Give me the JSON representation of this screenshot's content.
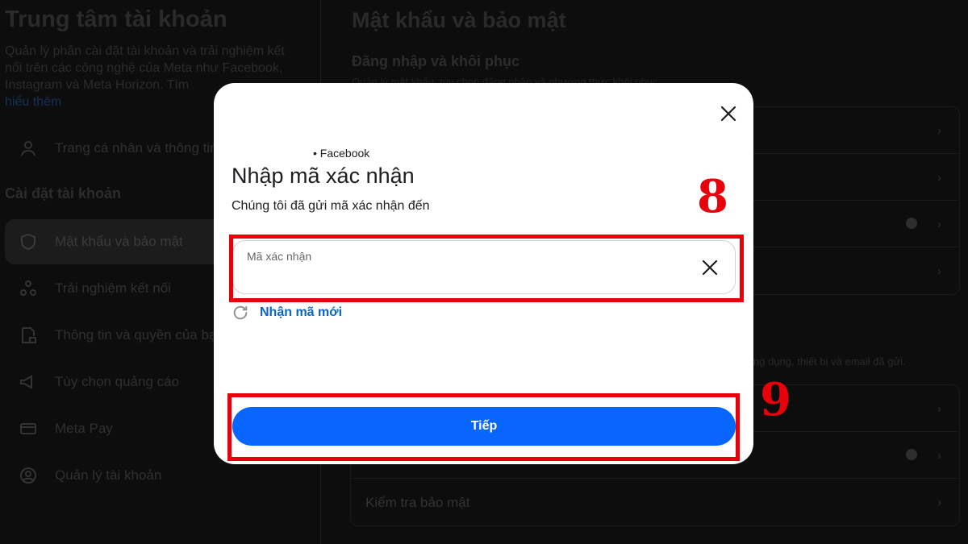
{
  "account_center": {
    "title": "Trung tâm tài khoản",
    "description": "Quản lý phần cài đặt tài khoản và trải nghiệm kết nối trên các công nghệ của Meta như Facebook, Instagram và Meta Horizon. Tìm",
    "learn_more": "hiểu thêm",
    "profile_item": "Trang cá nhân và thông tin",
    "settings_heading": "Cài đặt tài khoản",
    "nav": [
      {
        "label": "Mật khẩu và bảo mật",
        "icon": "shield-icon"
      },
      {
        "label": "Trải nghiệm kết nối",
        "icon": "connected-icon"
      },
      {
        "label": "Thông tin và quyền của bạn",
        "icon": "document-lock-icon"
      },
      {
        "label": "Tùy chọn quảng cáo",
        "icon": "megaphone-icon"
      },
      {
        "label": "Meta Pay",
        "icon": "card-icon"
      },
      {
        "label": "Quản lý tài khoản",
        "icon": "user-circle-icon"
      }
    ]
  },
  "security_page": {
    "title": "Mật khẩu và bảo mật",
    "login_section": "Đăng nhập và khôi phục",
    "login_section_desc": "Quản lý mật khẩu, tùy chọn đăng nhập và phương thức khôi phục.",
    "checks_desc": "ng dụng, thiết bị và email đã gửi.",
    "security_check": "Kiểm tra bảo mật"
  },
  "modal": {
    "brand": "• Facebook",
    "title": "Nhập mã xác nhận",
    "subtitle": "Chúng tôi đã gửi mã xác nhận đến",
    "code_placeholder": "Mã xác nhận",
    "resend_label": "Nhận mã mới",
    "submit_label": "Tiếp"
  },
  "annotations": {
    "step_input": "8",
    "step_button": "9",
    "highlight_color": "#e8000b"
  },
  "colors": {
    "primary_button": "#0866ff",
    "link": "#0a66c2",
    "backdrop": "#0d0d0d"
  }
}
